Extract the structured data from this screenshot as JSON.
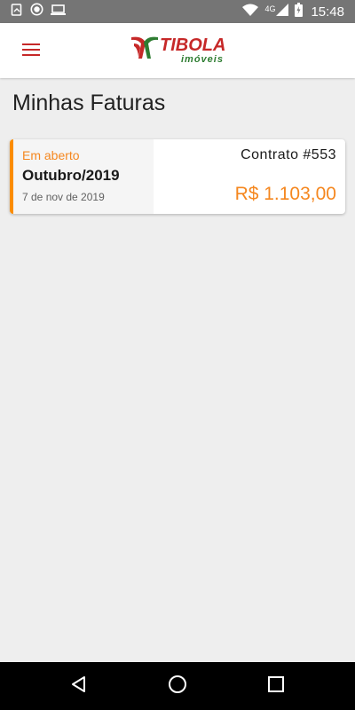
{
  "status_bar": {
    "network": "4G",
    "time": "15:48",
    "icons": [
      "sync-icon",
      "record-icon",
      "laptop-icon",
      "wifi-icon",
      "signal-icon",
      "battery-icon"
    ]
  },
  "app_bar": {
    "menu_icon": "hamburger-menu-icon",
    "logo_text": "TIBOLA",
    "logo_subtext": "imóveis",
    "colors": {
      "brand_red": "#c62828",
      "brand_green": "#2e7d32"
    }
  },
  "page": {
    "title": "Minhas Faturas"
  },
  "invoices": [
    {
      "status": "Em aberto",
      "month": "Outubro/2019",
      "date": "7 de nov de 2019",
      "contract": "Contrato #553",
      "amount": "R$ 1.103,00",
      "accent_color": "#fb8c00"
    }
  ],
  "nav_bar": {
    "icons": [
      "back-icon",
      "home-icon",
      "recents-icon"
    ]
  }
}
